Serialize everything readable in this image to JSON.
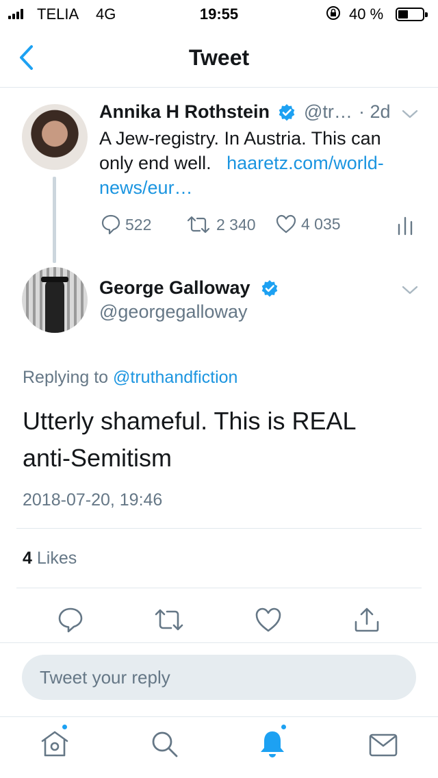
{
  "status_bar": {
    "carrier": "TELIA",
    "network": "4G",
    "time": "19:55",
    "battery": "40 %"
  },
  "nav": {
    "title": "Tweet"
  },
  "parent_tweet": {
    "name": "Annika H Rothstein",
    "handle": "@tr…",
    "age": "· 2d",
    "text_line1": "A Jew-registry. In Austria. This can",
    "text_line2": "only end well.",
    "link_line2": "haaretz.com/world-",
    "link_line3": "news/eur…",
    "replies": "522",
    "retweets": "2 340",
    "likes": "4 035"
  },
  "main_tweet": {
    "name": "George Galloway",
    "handle": "@georgegalloway",
    "replying_prefix": "Replying to",
    "replying_to": "@truthandfiction",
    "text": "Utterly shameful. This is REAL anti-Semitism",
    "timestamp": "2018-07-20, 19:46",
    "likes_count": "4",
    "likes_label": "Likes"
  },
  "reply_box": {
    "placeholder": "Tweet your reply"
  },
  "colors": {
    "accent": "#1da1f2",
    "link": "#1b95e0",
    "muted": "#657786",
    "divider": "#e1e8ed"
  },
  "icons": [
    "back-chevron-icon",
    "verified-badge-icon",
    "chevron-down-icon",
    "reply-icon",
    "retweet-icon",
    "like-icon",
    "analytics-icon",
    "share-icon",
    "home-icon",
    "search-icon",
    "notifications-bell-icon",
    "messages-envelope-icon"
  ]
}
